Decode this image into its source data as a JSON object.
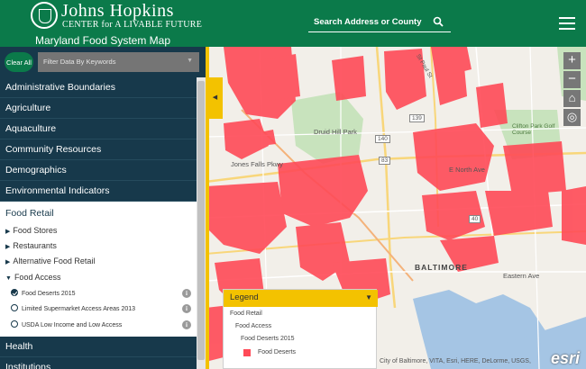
{
  "logo": {
    "title": "Johns Hopkins",
    "subtitle": "CENTER for A LIVABLE FUTURE"
  },
  "app_title": "Maryland Food System Map",
  "search": {
    "placeholder": "Search Address or County"
  },
  "filter": {
    "clear_label": "Clear All",
    "placeholder": "Filter Data By Keywords"
  },
  "categories_top": [
    "Administrative Boundaries",
    "Agriculture",
    "Aquaculture",
    "Community Resources",
    "Demographics",
    "Environmental Indicators"
  ],
  "open_category": {
    "label": "Food Retail",
    "subs": [
      "Food Stores",
      "Restaurants",
      "Alternative Food Retail",
      "Food Access"
    ],
    "layers": [
      {
        "label": "Food Deserts 2015",
        "checked": true
      },
      {
        "label": "Limited Supermarket Access Areas 2013",
        "checked": false
      },
      {
        "label": "USDA Low Income and Low Access",
        "checked": false
      }
    ]
  },
  "categories_bottom": [
    "Health",
    "Institutions"
  ],
  "legend": {
    "title": "Legend",
    "level1": "Food Retail",
    "level2": "Food Access",
    "level3": "Food Deserts 2015",
    "item": "Food Deserts",
    "color": "#ff4a57"
  },
  "map": {
    "labels": {
      "park": "Druid Hill Park",
      "city": "BALTIMORE",
      "jones": "Jones Falls Pkwy",
      "north": "E North Ave",
      "eastern": "Eastern Ave",
      "clifton": "Clifton Park Golf Course",
      "r83": "83",
      "r40": "40",
      "r139": "139",
      "r140": "140",
      "stpaul": "St Paul St"
    },
    "attribution": "City of Baltimore, VITA, Esri, HERE, DeLorme, USGS,",
    "esri_logo": "esri"
  },
  "controls": {
    "zoom_in": "+",
    "zoom_out": "−",
    "home": "⌂",
    "locate": "◎"
  }
}
